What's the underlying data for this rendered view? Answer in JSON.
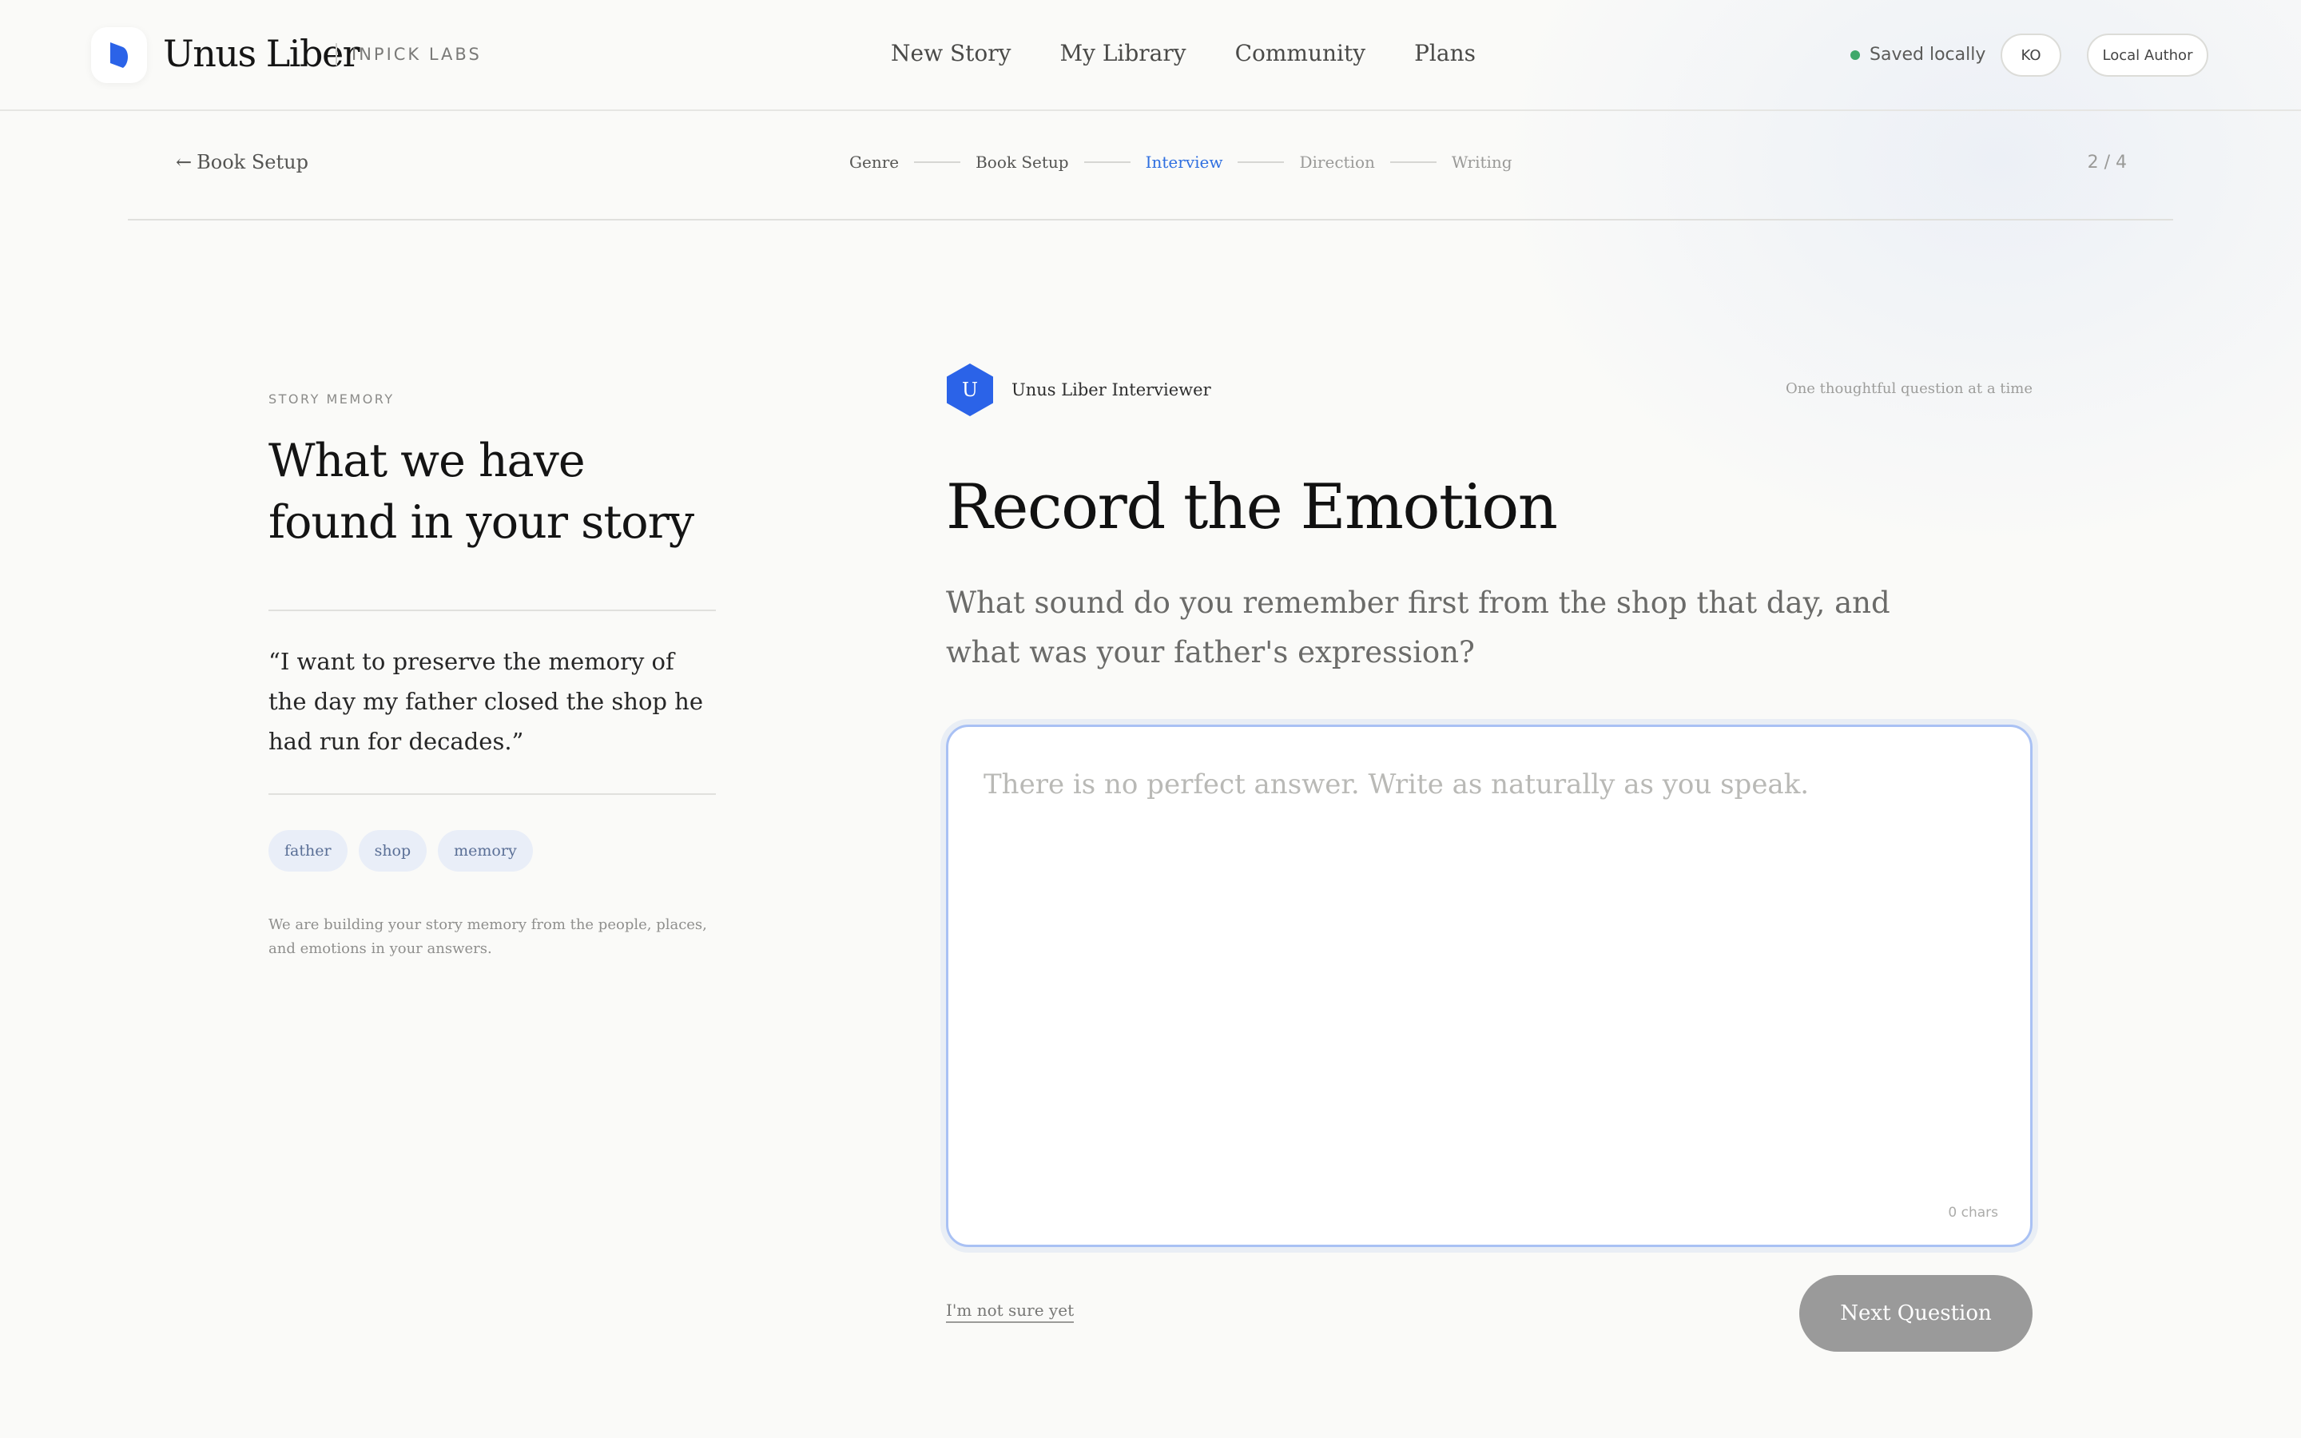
{
  "brand": {
    "name": "Unus Liber",
    "sub": "INPICK LABS",
    "accent": "#2b63e8"
  },
  "nav": {
    "items": [
      "New Story",
      "My Library",
      "Community",
      "Plans"
    ]
  },
  "header": {
    "status": "Saved locally",
    "status_color": "#3fa86a",
    "lang": "KO",
    "author": "Local Author"
  },
  "stepbar": {
    "back": "Book Setup",
    "steps": [
      "Genre",
      "Book Setup",
      "Interview",
      "Direction",
      "Writing"
    ],
    "active_step": "Interview",
    "count": "2 / 4"
  },
  "memory": {
    "eyebrow": "STORY MEMORY",
    "title": "What we have found in your story",
    "quote": "“I want to preserve the memory of the day my father closed the shop he had run for decades.”",
    "tags": [
      "father",
      "shop",
      "memory"
    ],
    "note": "We are building your story memory from the people, places, and emotions in your answers."
  },
  "interview": {
    "avatar_letter": "U",
    "interviewer": "Unus Liber Interviewer",
    "hint": "One thoughtful question at a time",
    "title": "Record the Emotion",
    "question": "What sound do you remember first from the shop that day, and what was your father's expression?",
    "answer_value": "",
    "answer_placeholder": "There is no perfect answer. Write as naturally as you speak.",
    "char_count": "0 chars",
    "skip_label": "I'm not sure yet",
    "next_label": "Next Question"
  }
}
